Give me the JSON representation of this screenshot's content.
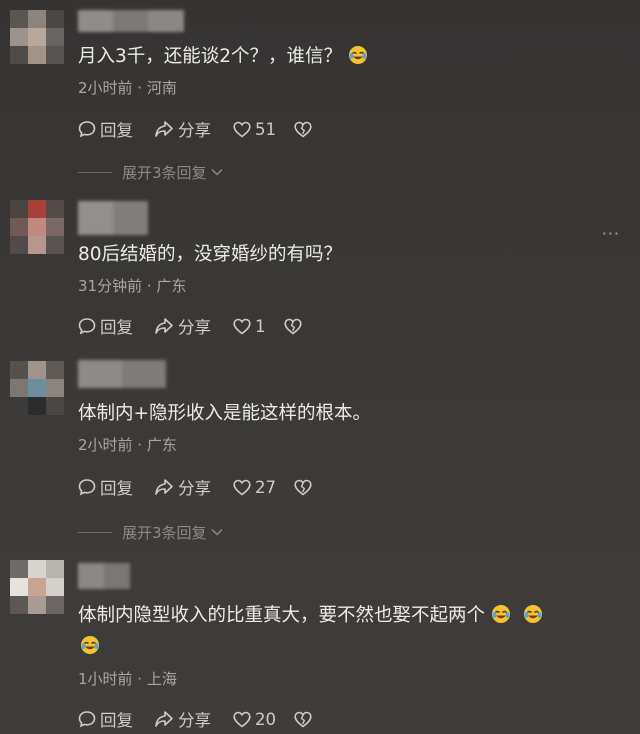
{
  "comments": [
    {
      "text": "月入3千，还能谈2个？，谁信？",
      "meta": "2小时前 · 河南",
      "reply_label": "回复",
      "share_label": "分享",
      "like_count": "51",
      "expand_label": "展开3条回复"
    },
    {
      "text": "80后结婚的，没穿婚纱的有吗？",
      "meta": "31分钟前 · 广东",
      "reply_label": "回复",
      "share_label": "分享",
      "like_count": "1"
    },
    {
      "text": "体制内+隐形收入是能这样的根本。",
      "meta": "2小时前 · 广东",
      "reply_label": "回复",
      "share_label": "分享",
      "like_count": "27",
      "expand_label": "展开3条回复"
    },
    {
      "text": "体制内隐型收入的比重真大，要不然也娶不起两个",
      "meta": "1小时前 · 上海",
      "reply_label": "回复",
      "share_label": "分享",
      "like_count": "20"
    }
  ],
  "more_menu": "···",
  "emoji_name": "laugh-cry-emoji"
}
